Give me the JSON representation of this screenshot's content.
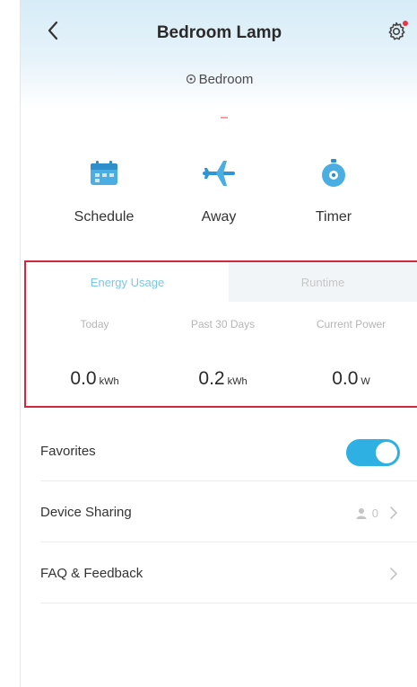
{
  "header": {
    "title": "Bedroom Lamp",
    "location": "Bedroom",
    "back_icon": "chevron-left-icon",
    "settings_icon": "gear-icon",
    "accent": "#e8334a"
  },
  "actions": [
    {
      "label": "Schedule",
      "icon": "calendar-icon"
    },
    {
      "label": "Away",
      "icon": "airplane-icon"
    },
    {
      "label": "Timer",
      "icon": "stopwatch-icon"
    }
  ],
  "energy": {
    "tabs": [
      {
        "label": "Energy Usage",
        "selected": true
      },
      {
        "label": "Runtime",
        "selected": false
      }
    ],
    "stats": [
      {
        "label": "Today",
        "value": "0.0",
        "unit": "kWh"
      },
      {
        "label": "Past 30 Days",
        "value": "0.2",
        "unit": "kWh"
      },
      {
        "label": "Current Power",
        "value": "0.0",
        "unit": "W"
      }
    ],
    "highlight_color": "#d0283c"
  },
  "list": {
    "favorites": {
      "label": "Favorites",
      "toggle_on": true
    },
    "device_sharing": {
      "label": "Device Sharing",
      "count": "0"
    },
    "faq": {
      "label": "FAQ & Feedback"
    }
  },
  "colors": {
    "accent_blue": "#2fb0e3",
    "tab_active": "#7cc7e3"
  }
}
